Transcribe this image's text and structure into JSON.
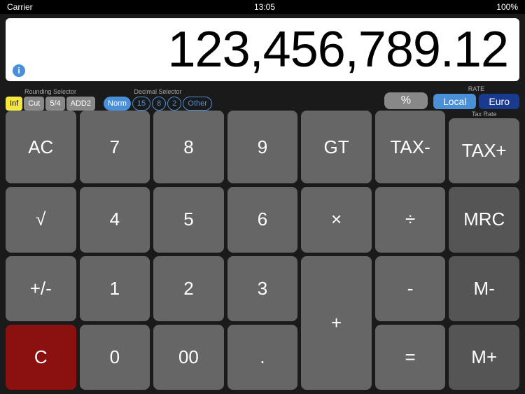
{
  "status_bar": {
    "carrier": "Carrier",
    "time": "13:05",
    "battery": "100%"
  },
  "display": {
    "value": "123,456,789.12",
    "info_icon": "i"
  },
  "rounding": {
    "label": "Rounding Selector",
    "buttons": [
      "Inf",
      "Cut",
      "5/4",
      "ADD2"
    ]
  },
  "decimal": {
    "label": "Decimal Selector",
    "buttons": [
      "Norm",
      "15",
      "8",
      "2",
      "Other"
    ]
  },
  "rate": {
    "label": "RATE",
    "local": "Local",
    "euro": "Euro"
  },
  "percent_btn": "%",
  "tax_rate_label": "Tax Rate",
  "buttons": {
    "row1": [
      "AC",
      "7",
      "8",
      "9",
      "GT",
      "TAX-",
      "TAX+"
    ],
    "row2": [
      "√",
      "4",
      "5",
      "6",
      "×",
      "÷",
      "MRC"
    ],
    "row3": [
      "+/-",
      "1",
      "2",
      "3",
      "",
      "-",
      "M-"
    ],
    "row4": [
      "C",
      "0",
      "00",
      ".",
      "",
      "=",
      "M+"
    ]
  },
  "plus_btn": "+"
}
